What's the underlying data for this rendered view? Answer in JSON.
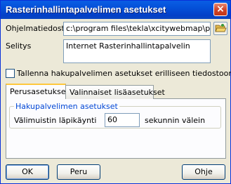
{
  "window": {
    "title": "Rasterinhallintapalvelimen asetukset",
    "close_glyph": "×"
  },
  "form": {
    "program_label": "Ohjelmatiedosto",
    "program_value": "c:\\program files\\tekla\\xcitywebmap\\progr",
    "description_label": "Selitys",
    "description_value": "Internet Rasterinhallintapalvelin",
    "save_separately_label": "Tallenna hakupalvelimen asetukset erilliseen tiedostoon",
    "save_separately_checked": false
  },
  "tabs": [
    {
      "label": "Perusasetukset",
      "active": true
    },
    {
      "label": "Valinnaiset lisäasetukset",
      "active": false
    }
  ],
  "group": {
    "title": "Hakupalvelimen asetukset",
    "cache_label": "Välimuistin läpikäynti",
    "cache_value": "60",
    "cache_unit": "sekunnin välein"
  },
  "buttons": {
    "ok": "OK",
    "cancel": "Peru",
    "help": "Ohje"
  },
  "icons": {
    "browse": "folder-open-icon",
    "close": "close-icon"
  },
  "colors": {
    "titlebar": "#0450d8",
    "group_title": "#0046d5",
    "dialog_bg": "#ece9d8"
  }
}
